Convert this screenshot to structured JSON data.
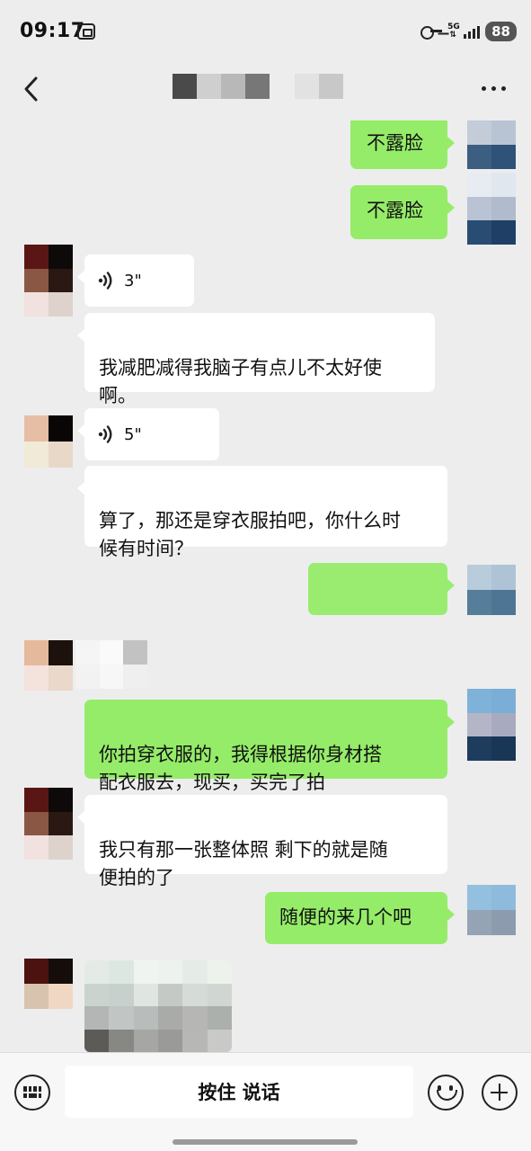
{
  "status_bar": {
    "time": "09:17",
    "network": "5G",
    "battery": "88",
    "icons": [
      "screen-record-icon",
      "vpn-key-icon",
      "network-5g-icon",
      "signal-icon",
      "battery-icon"
    ]
  },
  "nav": {
    "back_icon": "chevron-left-icon",
    "more_icon": "more-dots-icon",
    "title_mosaic_colors": [
      "#4a4a4a",
      "#cfcfcf",
      "#b8b8b8",
      "#777777",
      "#ededed",
      "#d5d5d5",
      "#c8c8c8"
    ]
  },
  "messages": [
    {
      "side": "out",
      "type": "text",
      "text": "不露脸"
    },
    {
      "side": "out",
      "type": "text",
      "text": "不露脸"
    },
    {
      "side": "in",
      "type": "voice",
      "duration": "3\""
    },
    {
      "side": "in",
      "type": "text",
      "text": "我减肥减得我脑子有点儿不太好使\n啊。"
    },
    {
      "side": "in",
      "type": "voice",
      "duration": "5\""
    },
    {
      "side": "in",
      "type": "text",
      "text": "算了，那还是穿衣服拍吧，你什么时\n候有时间？"
    },
    {
      "side": "out",
      "type": "redacted",
      "text": ""
    },
    {
      "side": "in",
      "type": "redacted",
      "text": ""
    },
    {
      "side": "out",
      "type": "text",
      "text": "你拍穿衣服的，我得根据你身材搭\n配衣服去，现买，买完了拍"
    },
    {
      "side": "in",
      "type": "text",
      "text": "我只有那一张整体照 剩下的就是随\n便拍的了"
    },
    {
      "side": "out",
      "type": "text",
      "text": "随便的来几个吧"
    },
    {
      "side": "in",
      "type": "image",
      "text": ""
    }
  ],
  "avatars": {
    "me": [
      "#c3ccd8",
      "#b8c4d3",
      "#3c5e80",
      "#2e5278"
    ],
    "other": [
      "#5a1614",
      "#0d0a09",
      "#8a5744",
      "#2a1812",
      "#f1e2e0",
      "#ddd2cc"
    ]
  },
  "input_bar": {
    "hold_to_talk_label": "按住 说话",
    "keyboard_icon": "keyboard-icon",
    "emoji_icon": "emoji-icon",
    "plus_icon": "plus-icon"
  }
}
